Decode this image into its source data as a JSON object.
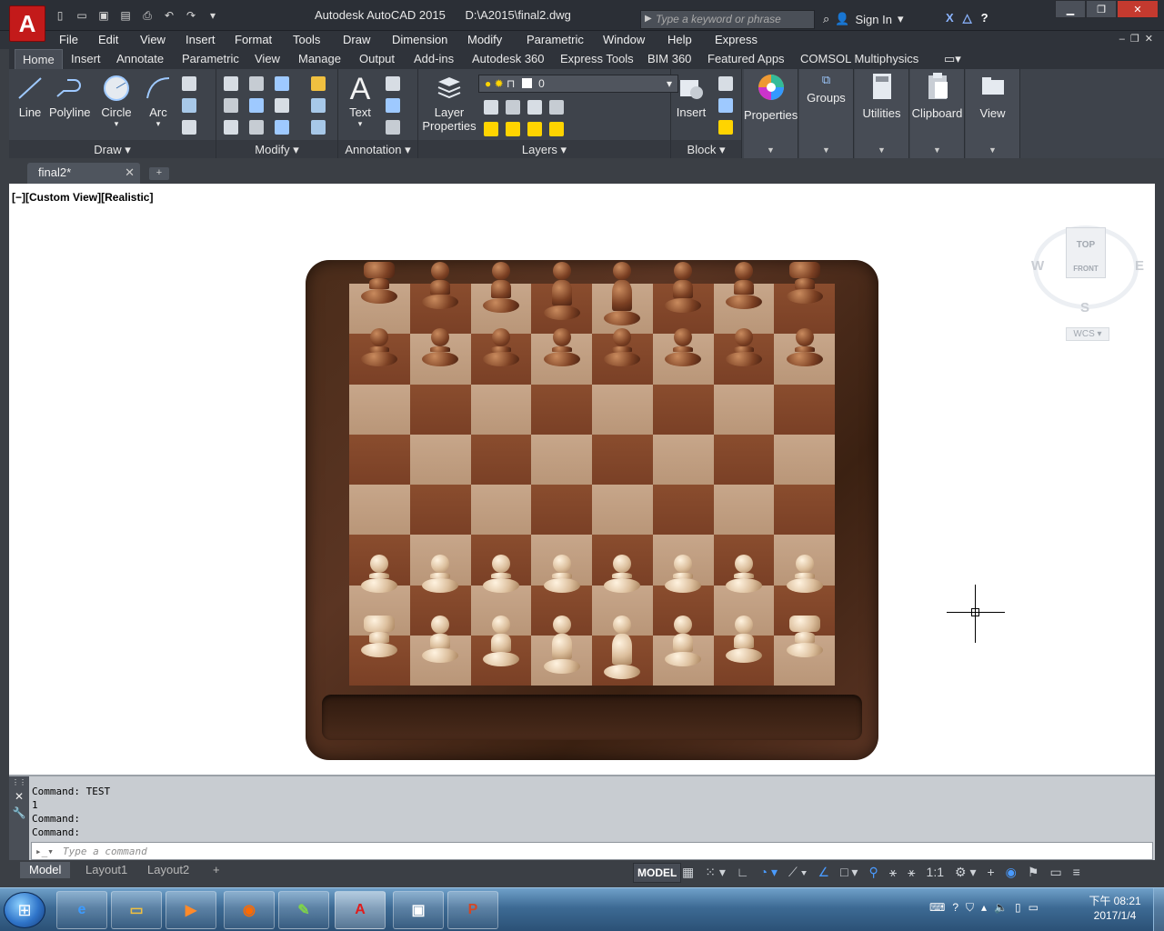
{
  "titlebar": {
    "app": "Autodesk AutoCAD 2015",
    "file": "D:\\A2015\\final2.dwg",
    "search_placeholder": "Type a keyword or phrase",
    "signin": "Sign In"
  },
  "menu": [
    "File",
    "Edit",
    "View",
    "Insert",
    "Format",
    "Tools",
    "Draw",
    "Dimension",
    "Modify",
    "Parametric",
    "Window",
    "Help",
    "Express"
  ],
  "ribbon_tabs": [
    "Home",
    "Insert",
    "Annotate",
    "Parametric",
    "View",
    "Manage",
    "Output",
    "Add-ins",
    "Autodesk 360",
    "Express Tools",
    "BIM 360",
    "Featured Apps",
    "COMSOL Multiphysics"
  ],
  "draw_tools": [
    "Line",
    "Polyline",
    "Circle",
    "Arc"
  ],
  "panels": {
    "draw": "Draw",
    "modify": "Modify",
    "annotation": "Annotation",
    "layers": "Layers",
    "block": "Block"
  },
  "annotation_tool": "Text",
  "layer_props": [
    "Layer",
    "Properties"
  ],
  "layer_current": "0",
  "block_tool": "Insert",
  "big_panels": [
    "Properties",
    "Groups",
    "Utilities",
    "Clipboard",
    "View"
  ],
  "doc_tab": "final2*",
  "viewport_label": "[−][Custom View][Realistic]",
  "viewcube": {
    "top": "TOP",
    "front": "FRONT",
    "w": "W",
    "e": "E",
    "s": "S",
    "wcs": "WCS"
  },
  "command_history": [
    "Command: TEST",
    "1",
    "Command:",
    "Command:"
  ],
  "command_placeholder": "Type a command",
  "layout_tabs": [
    "Model",
    "Layout1",
    "Layout2"
  ],
  "status": {
    "model": "MODEL",
    "scale": "1:1"
  },
  "clock": {
    "time": "下午 08:21",
    "date": "2017/1/4"
  },
  "colors": {
    "accent": "#c31a1a",
    "ribbon": "#3e434b",
    "board_light": "#c7a68a",
    "board_dark": "#8a4d2e"
  }
}
